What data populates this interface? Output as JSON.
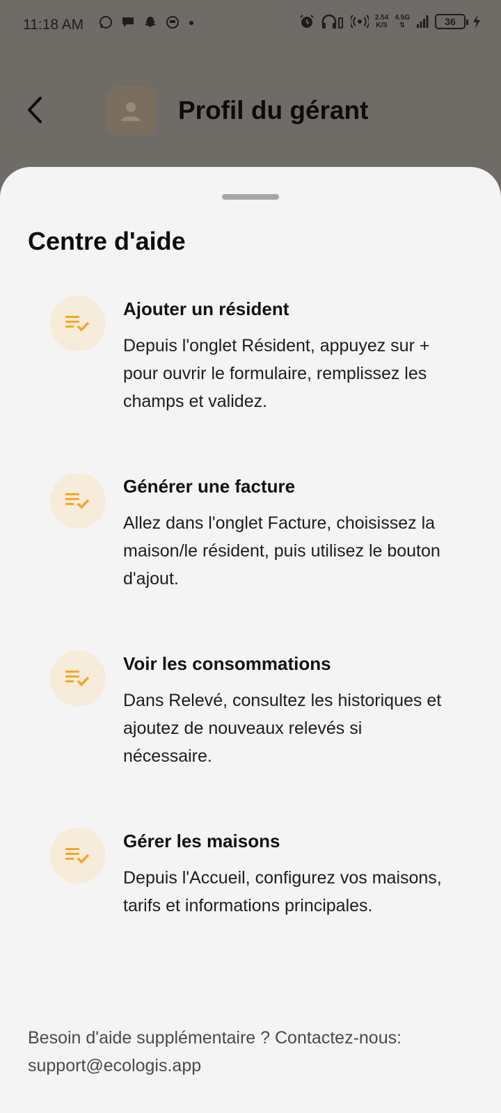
{
  "status_bar": {
    "time": "11:18 AM",
    "net_speed_value": "2.54",
    "net_speed_unit": "K/S",
    "network_type": "4.5G",
    "battery": "36",
    "icons": [
      "whatsapp-icon",
      "chat-icon",
      "snapchat-icon",
      "app-icon",
      "dot-icon",
      "alarm-icon",
      "headphones-icon",
      "hotspot-icon",
      "signal-icon",
      "charging-icon"
    ]
  },
  "header": {
    "title": "Profil du gérant"
  },
  "sheet": {
    "title": "Centre d'aide",
    "items": [
      {
        "title": "Ajouter un résident",
        "description": "Depuis l'onglet Résident, appuyez sur + pour ouvrir le formulaire, remplissez les champs et validez."
      },
      {
        "title": "Générer une facture",
        "description": "Allez dans l'onglet Facture, choisissez la maison/le résident, puis utilisez le bouton d'ajout."
      },
      {
        "title": "Voir les consommations",
        "description": "Dans Relevé, consultez les historiques et ajoutez de nouveaux relevés si nécessaire."
      },
      {
        "title": "Gérer les maisons",
        "description": "Depuis l'Accueil, configurez vos maisons, tarifs et informations principales."
      }
    ],
    "footer": "Besoin d'aide supplémentaire ? Contactez-nous: support@ecologis.app"
  },
  "colors": {
    "accent": "#f5a623",
    "icon_bg": "#f7ebd9",
    "sheet_bg": "#f4f4f4",
    "scrim": "#6f6c67"
  }
}
